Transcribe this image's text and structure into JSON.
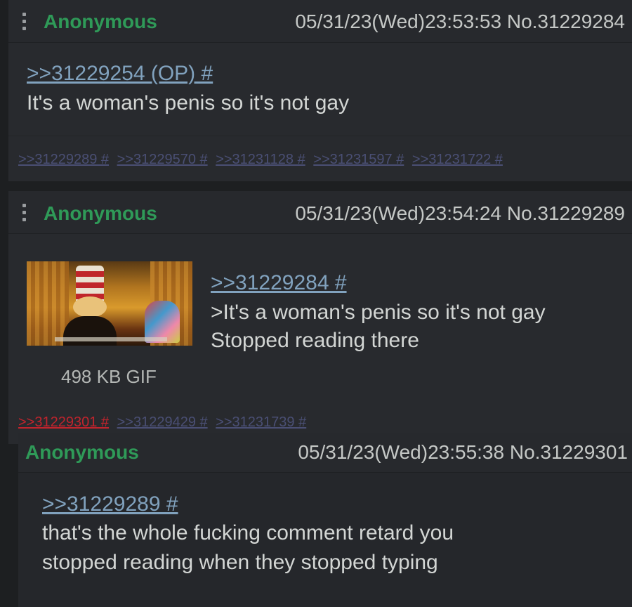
{
  "posts": [
    {
      "name": "Anonymous",
      "datetime": "05/31/23(Wed)23:53:53",
      "number": "No.31229284",
      "quote": ">>31229254 (OP) #",
      "lines": [
        "It's a woman's penis so it's not gay"
      ],
      "backlinks": [
        ">>31229289 #",
        ">>31229570 #",
        ">>31231128 #",
        ">>31231597 #",
        ">>31231722 #"
      ]
    },
    {
      "name": "Anonymous",
      "datetime": "05/31/23(Wed)23:54:24",
      "number": "No.31229289",
      "file_info": "498 KB GIF",
      "quote": ">>31229284 #",
      "greentext": ">It's a woman's penis so it's not gay",
      "lines": [
        "Stopped reading there"
      ],
      "backlinks": [
        ">>31229301 #",
        ">>31229429 #",
        ">>31231739 #"
      ]
    },
    {
      "name": "Anonymous",
      "datetime": "05/31/23(Wed)23:55:38",
      "number": "No.31229301",
      "quote": ">>31229289 #",
      "lines": [
        "that's the whole fucking comment retard you",
        "stopped reading when they stopped typing"
      ]
    }
  ],
  "colors": {
    "background": "#1d1f21",
    "post": "#282a2e",
    "name": "#2f9a58",
    "quote_link": "#81a2be",
    "greentext": "#9db54d",
    "highlighted_backlink": "#c0242d"
  },
  "icons": [
    "menu-dots-icon"
  ]
}
